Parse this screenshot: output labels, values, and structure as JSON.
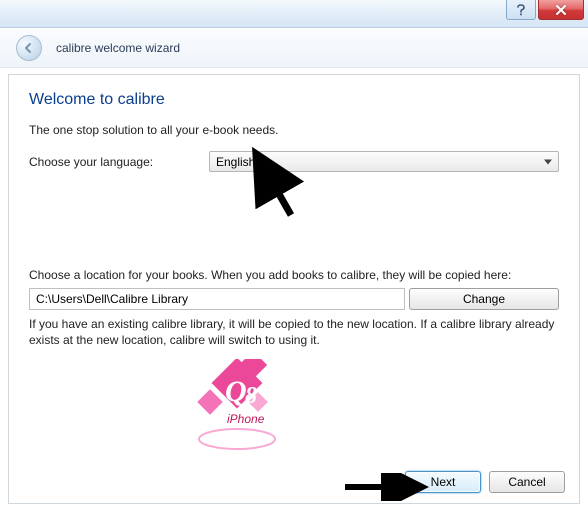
{
  "window": {
    "title": "calibre welcome wizard"
  },
  "heading": "Welcome to calibre",
  "tagline": "The one stop solution to all your e-book needs.",
  "language": {
    "label": "Choose your language:",
    "selected": "English"
  },
  "location": {
    "description": "Choose a location for your books. When you add books to calibre, they will be copied here:",
    "path": "C:\\Users\\Dell\\Calibre Library",
    "change_label": "Change",
    "info": "If you have an existing calibre library, it will be copied to the new location. If a calibre library already exists at the new location, calibre will switch to using it."
  },
  "buttons": {
    "next": "Next",
    "cancel": "Cancel"
  },
  "watermark": {
    "brand": "Q8",
    "subtext": "iPhone"
  }
}
